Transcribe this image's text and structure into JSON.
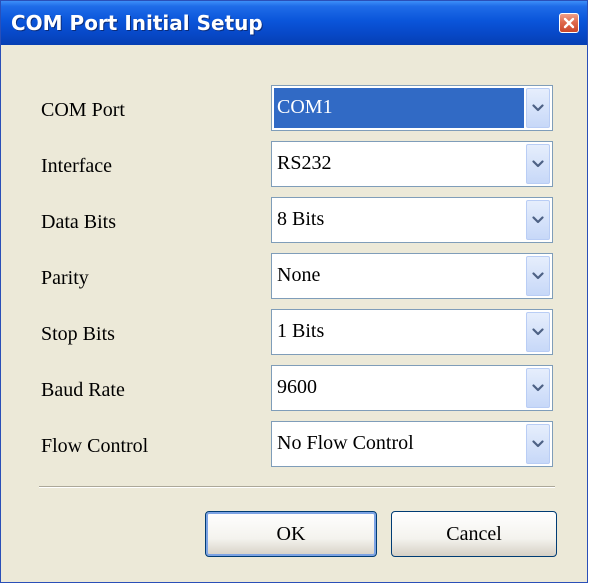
{
  "window": {
    "title": "COM Port Initial Setup",
    "close_icon": "close-icon"
  },
  "fields": [
    {
      "label": "COM Port",
      "value": "COM1",
      "selected": true
    },
    {
      "label": "Interface",
      "value": "RS232",
      "selected": false
    },
    {
      "label": "Data Bits",
      "value": "8 Bits",
      "selected": false
    },
    {
      "label": "Parity",
      "value": "None",
      "selected": false
    },
    {
      "label": "Stop Bits",
      "value": "1 Bits",
      "selected": false
    },
    {
      "label": "Baud Rate",
      "value": "9600",
      "selected": false
    },
    {
      "label": "Flow Control",
      "value": "No Flow Control",
      "selected": false
    }
  ],
  "buttons": {
    "ok_label": "OK",
    "cancel_label": "Cancel"
  },
  "colors": {
    "titlebar": "#0a55da",
    "selection": "#316ac5",
    "face": "#ece9d8",
    "close": "#df6a4e"
  },
  "icons": {
    "dropdown": "chevron-down-icon",
    "close": "close-icon"
  }
}
